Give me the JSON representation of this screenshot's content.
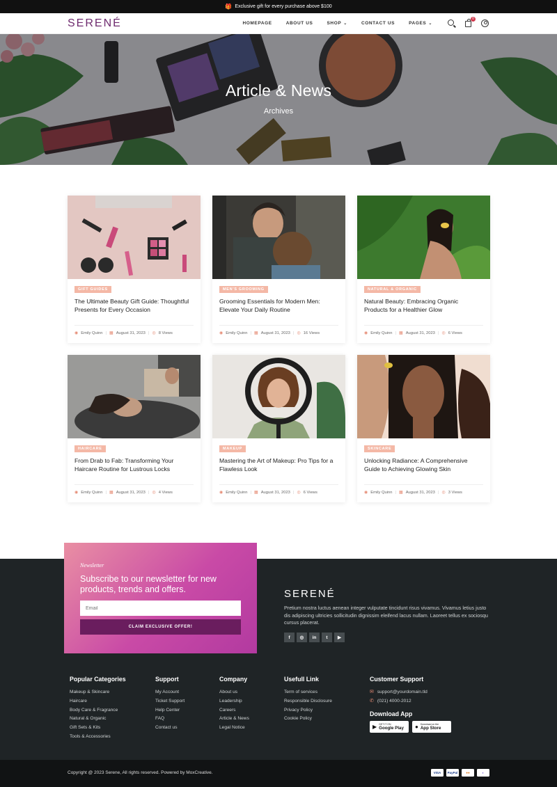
{
  "announcement": {
    "icon": "gift-icon",
    "text": "Exclusive gift for every purchase above $100"
  },
  "header": {
    "logo": "SERENÉ",
    "nav": [
      {
        "label": "HOMEPAGE",
        "dropdown": false
      },
      {
        "label": "ABOUT US",
        "dropdown": false
      },
      {
        "label": "SHOP",
        "dropdown": true
      },
      {
        "label": "CONTACT US",
        "dropdown": false
      },
      {
        "label": "PAGES",
        "dropdown": true
      }
    ],
    "cart_count": "0"
  },
  "hero": {
    "title": "Article & News",
    "subtitle": "Archives"
  },
  "posts": [
    {
      "tag": "GIFT GUIDES",
      "title": "The Ultimate Beauty Gift Guide: Thoughtful Presents for Every Occasion",
      "author": "Emily Quinn",
      "date": "August 31, 2023",
      "views": "8 Views",
      "image": "flatlay-cosmetics"
    },
    {
      "tag": "MEN'S GROOMING",
      "title": "Grooming Essentials for Modern Men: Elevate Your Daily Routine",
      "author": "Emily Quinn",
      "date": "August 31, 2023",
      "views": "16 Views",
      "image": "barber-shop"
    },
    {
      "tag": "NATURAL & ORGANIC",
      "title": "Natural Beauty: Embracing Organic Products for a Healthier Glow",
      "author": "Emily Quinn",
      "date": "August 31, 2023",
      "views": "6 Views",
      "image": "woman-leaves"
    },
    {
      "tag": "HAIRCARE",
      "title": "From Drab to Fab: Transforming Your Haircare Routine for Lustrous Locks",
      "author": "Emily Quinn",
      "date": "August 31, 2023",
      "views": "4 Views",
      "image": "hair-wash"
    },
    {
      "tag": "MAKEUP",
      "title": "Mastering the Art of Makeup: Pro Tips for a Flawless Look",
      "author": "Emily Quinn",
      "date": "August 31, 2023",
      "views": "6 Views",
      "image": "ring-light"
    },
    {
      "tag": "SKINCARE",
      "title": "Unlocking Radiance: A Comprehensive Guide to Achieving Glowing Skin",
      "author": "Emily Quinn",
      "date": "August 31, 2023",
      "views": "3 Views",
      "image": "two-women"
    }
  ],
  "newsletter": {
    "kicker": "Newsletter",
    "heading": "Subscribe to our newsletter for new products, trends and offers.",
    "placeholder": "Email",
    "button": "CLAIM EXCLUSIVE OFFER!"
  },
  "footer_brand": {
    "logo": "SERENÉ",
    "description": "Pretium nostra luctus aenean integer vulputate tincidunt risus vivamus. Vivamus letius justo dis adipiscing ultricies sollicitudin dignissim eleifend lacus nullam. Laoreet tellus ex sociosqu cursus placerat.",
    "socials": [
      "f",
      "ig",
      "in",
      "tw",
      "yt"
    ]
  },
  "footer_cols": [
    {
      "title": "Popular Categories",
      "links": [
        "Makeup & Skincare",
        "Haircare",
        "Body Care & Fragrance",
        "Natural & Organic",
        "Gift Sets & Kits",
        "Tools & Accessories"
      ]
    },
    {
      "title": "Support",
      "links": [
        "My Account",
        "Ticket Support",
        "Help Center",
        "FAQ",
        "Contact us"
      ]
    },
    {
      "title": "Company",
      "links": [
        "About us",
        "Leadership",
        "Careers",
        "Article & News",
        "Legal Notice"
      ]
    },
    {
      "title": "Usefull Link",
      "links": [
        "Term of services",
        "Responsible Disclosure",
        "Privacy Policy",
        "Cookie Policy"
      ]
    }
  ],
  "customer_support": {
    "title": "Customer Support",
    "email": "support@yourdomain.tld",
    "phone": "(021) 4000-2012",
    "download_title": "Download App",
    "google_small": "GET IT ON",
    "google": "Google Play",
    "apple_small": "Download on the",
    "apple": "App Store"
  },
  "bottom": {
    "copyright": "Copyright @ 2023 Serene, All rights reserved. Powered by MoxCreative.",
    "payments": [
      "VISA",
      "PayPal",
      "MC",
      "Pay"
    ]
  }
}
